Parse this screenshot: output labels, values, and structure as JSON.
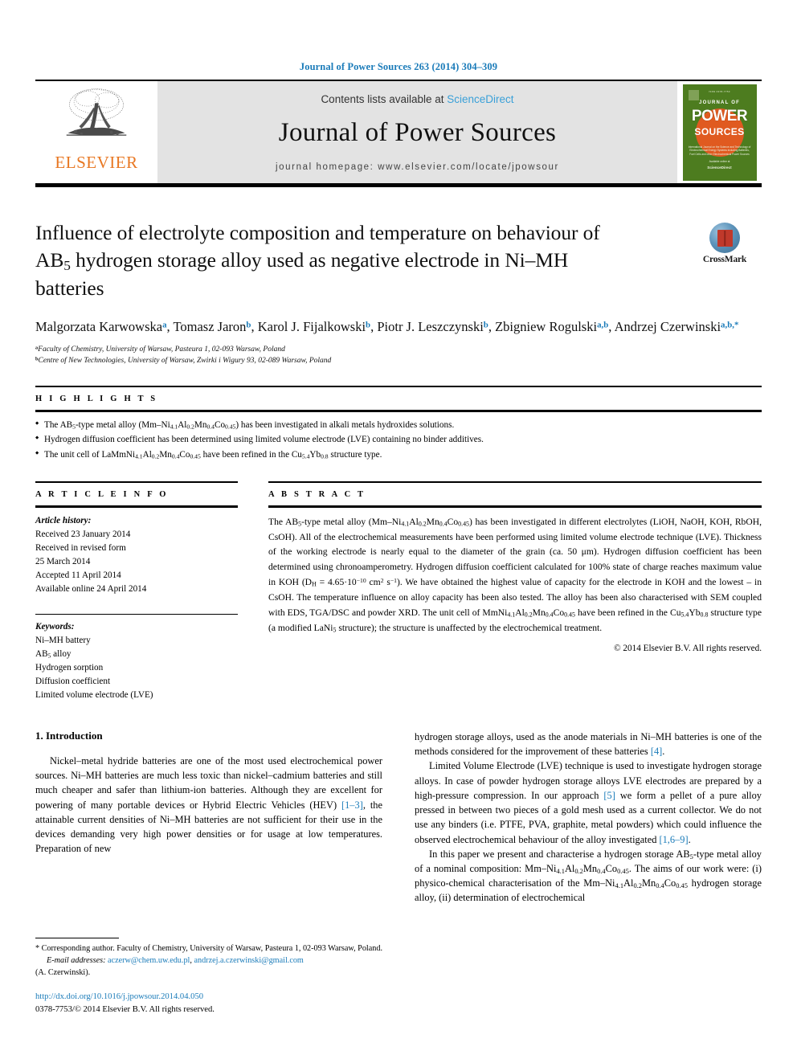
{
  "running_head": "Journal of Power Sources 263 (2014) 304–309",
  "masthead": {
    "publisher": "ELSEVIER",
    "contents_prefix": "Contents lists available at ",
    "contents_link": "ScienceDirect",
    "journal_title": "Journal of Power Sources",
    "homepage": "journal homepage: www.elsevier.com/locate/jpowsour",
    "cover": {
      "top_label": "ISSN 0378-7753",
      "journal_of": "JOURNAL OF",
      "power": "POWER",
      "sources": "SOURCES",
      "subtitle": "International Journal on the Science and Technology of Electrochemical Energy Systems including Batteries, Fuel Cells and other Electrochemical Power Sources",
      "foot_small": "Available online at",
      "foot_brand": "ScienceDirect"
    }
  },
  "article": {
    "title_line1": "Influence of electrolyte composition and temperature on behaviour of",
    "title_line2_a": "AB",
    "title_line2_sub": "5",
    "title_line2_b": " hydrogen storage alloy used as negative electrode in Ni–MH",
    "title_line3": "batteries",
    "crossmark_label": "CrossMark",
    "authors": [
      {
        "name": "Malgorzata Karwowska",
        "marks": "a",
        "sep": ", "
      },
      {
        "name": "Tomasz Jaron",
        "marks": "b",
        "sep": ", "
      },
      {
        "name": "Karol J. Fijalkowski",
        "marks": "b",
        "sep": ", "
      },
      {
        "name": "Piotr J. Leszczynski",
        "marks": "b",
        "sep": ", "
      },
      {
        "name": "Zbigniew Rogulski",
        "marks": "a,b",
        "sep": ", "
      },
      {
        "name": "Andrzej Czerwinski",
        "marks": "a,b,*",
        "sep": ""
      }
    ],
    "affiliations": [
      {
        "mark": "a",
        "text": "Faculty of Chemistry, University of Warsaw, Pasteura 1, 02-093 Warsaw, Poland"
      },
      {
        "mark": "b",
        "text": "Centre of New Technologies, University of Warsaw, Zwirki i Wigury 93, 02-089 Warsaw, Poland"
      }
    ]
  },
  "highlights": {
    "heading": "H I G H L I G H T S",
    "items": [
      "The AB5-type metal alloy (Mm–Ni4.1Al0.2Mn0.4Co0.45) has been investigated in alkali metals hydroxides solutions.",
      "Hydrogen diffusion coefficient has been determined using limited volume electrode (LVE) containing no binder additives.",
      "The unit cell of LaMmNi4.1Al0.2Mn0.4Co0.45 have been refined in the Cu5.4Yb0.8 structure type."
    ]
  },
  "article_info": {
    "heading": "A R T I C L E   I N F O",
    "history_label": "Article history:",
    "history": [
      "Received 23 January 2014",
      "Received in revised form",
      "25 March 2014",
      "Accepted 11 April 2014",
      "Available online 24 April 2014"
    ],
    "keywords_label": "Keywords:",
    "keywords": [
      "Ni–MH battery",
      "AB5 alloy",
      "Hydrogen sorption",
      "Diffusion coefficient",
      "Limited volume electrode (LVE)"
    ]
  },
  "abstract": {
    "heading": "A B S T R A C T",
    "text": "The AB5-type metal alloy (Mm–Ni4.1Al0.2Mn0.4Co0.45) has been investigated in different electrolytes (LiOH, NaOH, KOH, RbOH, CsOH). All of the electrochemical measurements have been performed using limited volume electrode technique (LVE). Thickness of the working electrode is nearly equal to the diameter of the grain (ca. 50 μm). Hydrogen diffusion coefficient has been determined using chronoamperometry. Hydrogen diffusion coefficient calculated for 100% state of charge reaches maximum value in KOH (DH = 4.65·10−10 cm2 s−1). We have obtained the highest value of capacity for the electrode in KOH and the lowest – in CsOH. The temperature influence on alloy capacity has been also tested. The alloy has been also characterised with SEM coupled with EDS, TGA/DSC and powder XRD. The unit cell of MmNi4.1Al0.2Mn0.4Co0.45 have been refined in the Cu5.4Yb0.8 structure type (a modified LaNi5 structure); the structure is unaffected by the electrochemical treatment.",
    "copyright": "© 2014 Elsevier B.V. All rights reserved."
  },
  "body": {
    "section_number_title": "1.  Introduction",
    "left_paragraph": "Nickel–metal hydride batteries are one of the most used electrochemical power sources. Ni–MH batteries are much less toxic than nickel–cadmium batteries and still much cheaper and safer than lithium-ion batteries. Although they are excellent for powering of many portable devices or Hybrid Electric Vehicles (HEV) [1–3], the attainable current densities of Ni–MH batteries are not sufficient for their use in the devices demanding very high power densities or for usage at low temperatures. Preparation of new",
    "right_paragraph_1": "hydrogen storage alloys, used as the anode materials in Ni–MH batteries is one of the methods considered for the improvement of these batteries [4].",
    "right_paragraph_2": "Limited Volume Electrode (LVE) technique is used to investigate hydrogen storage alloys. In case of powder hydrogen storage alloys LVE electrodes are prepared by a high-pressure compression. In our approach [5] we form a pellet of a pure alloy pressed in between two pieces of a gold mesh used as a current collector. We do not use any binders (i.e. PTFE, PVA, graphite, metal powders) which could influence the observed electrochemical behaviour of the alloy investigated [1,6–9].",
    "right_paragraph_3": "In this paper we present and characterise a hydrogen storage AB5-type metal alloy of a nominal composition: Mm–Ni4.1Al0.2Mn0.4Co0.45. The aims of our work were: (i) physico-chemical characterisation of the Mm–Ni4.1Al0.2Mn0.4Co0.45 hydrogen storage alloy, (ii) determination of electrochemical"
  },
  "footnote": {
    "corresponding": "* Corresponding author. Faculty of Chemistry, University of Warsaw, Pasteura 1, 02-093 Warsaw, Poland.",
    "email_label": "E-mail addresses:",
    "email_1": "aczerw@chem.uw.edu.pl",
    "email_sep": ", ",
    "email_2": "andrzej.a.czerwinski@gmail.com",
    "email_attrib": "(A. Czerwinski).",
    "doi": "http://dx.doi.org/10.1016/j.jpowsour.2014.04.050",
    "issn_line": "0378-7753/© 2014 Elsevier B.V. All rights reserved."
  },
  "colors": {
    "link_blue": "#1a7bb9",
    "sciencedirect_blue": "#3aa0d8",
    "elsevier_orange": "#E87722",
    "cover_green": "#4d7c1f",
    "band_grey": "#e3e3e3"
  }
}
